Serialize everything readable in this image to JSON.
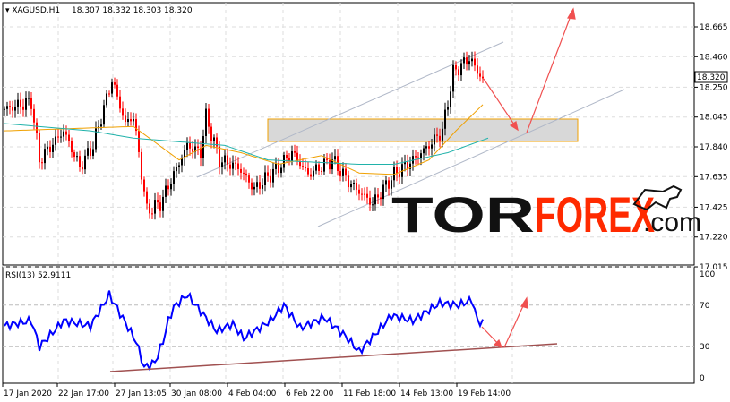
{
  "header": {
    "symbol": "XAGUSD,H1",
    "ohlc": "18.307 18.332 18.303 18.320"
  },
  "rsi_label": "RSI(13) 52.9111",
  "logo": {
    "tor": "TOR",
    "forex": "FOREX",
    "com": ".com"
  },
  "current_price": "18.320",
  "colors": {
    "bull": "#000000",
    "bear": "#ff0000",
    "ma_fast": "#f0a000",
    "ma_slow": "#20b2aa",
    "rsi": "#0000ff",
    "arrow": "#f05050",
    "channel": "#b0b8c8",
    "trend": "#a05050",
    "zone": "#d8d8d8",
    "zone_border": "#f0a000"
  },
  "chart_data": [
    {
      "type": "line",
      "title": "XAGUSD,H1",
      "ylim": [
        17.015,
        18.87
      ],
      "yticks": [
        "18.665",
        "18.460",
        "18.250",
        "18.045",
        "17.840",
        "17.635",
        "17.425",
        "17.220",
        "17.015"
      ],
      "xticks": [
        "17 Jan 2020",
        "22 Jan 17:00",
        "27 Jan 13:05",
        "30 Jan 08:00",
        "4 Feb 04:00",
        "6 Feb 22:00",
        "11 Feb 18:00",
        "14 Feb 13:00",
        "19 Feb 14:00"
      ],
      "price_path": [
        [
          0,
          18.1
        ],
        [
          10,
          18.15
        ],
        [
          13,
          17.75
        ],
        [
          22,
          17.95
        ],
        [
          28,
          17.7
        ],
        [
          33,
          17.85
        ],
        [
          40,
          18.3
        ],
        [
          45,
          18.0
        ],
        [
          48,
          18.05
        ],
        [
          53,
          17.4
        ],
        [
          58,
          17.45
        ],
        [
          63,
          17.65
        ],
        [
          68,
          17.85
        ],
        [
          73,
          17.8
        ],
        [
          75,
          18.05
        ],
        [
          80,
          17.75
        ],
        [
          87,
          17.7
        ],
        [
          93,
          17.55
        ],
        [
          102,
          17.7
        ],
        [
          107,
          17.8
        ],
        [
          113,
          17.65
        ],
        [
          122,
          17.75
        ],
        [
          128,
          17.6
        ],
        [
          137,
          17.45
        ],
        [
          145,
          17.65
        ],
        [
          152,
          17.75
        ],
        [
          158,
          17.85
        ],
        [
          163,
          17.95
        ],
        [
          167,
          18.35
        ],
        [
          173,
          18.45
        ],
        [
          178,
          18.3
        ]
      ],
      "ma_fast": [
        [
          0,
          17.95
        ],
        [
          48,
          17.98
        ],
        [
          65,
          17.75
        ],
        [
          75,
          17.85
        ],
        [
          88,
          17.8
        ],
        [
          102,
          17.72
        ],
        [
          118,
          17.78
        ],
        [
          132,
          17.66
        ],
        [
          145,
          17.65
        ],
        [
          158,
          17.75
        ],
        [
          168,
          17.95
        ],
        [
          178,
          18.13
        ]
      ],
      "ma_slow": [
        [
          0,
          18.0
        ],
        [
          32,
          17.95
        ],
        [
          48,
          17.9
        ],
        [
          82,
          17.85
        ],
        [
          98,
          17.75
        ],
        [
          132,
          17.72
        ],
        [
          145,
          17.72
        ],
        [
          165,
          17.8
        ],
        [
          180,
          17.9
        ]
      ]
    },
    {
      "type": "line",
      "title": "RSI(13)",
      "ylim": [
        0,
        100
      ],
      "yticks": [
        "100",
        "70",
        "30",
        "0"
      ],
      "values": [
        [
          0,
          50
        ],
        [
          10,
          55
        ],
        [
          13,
          30
        ],
        [
          22,
          55
        ],
        [
          32,
          50
        ],
        [
          39,
          80
        ],
        [
          43,
          62
        ],
        [
          49,
          35
        ],
        [
          52,
          10
        ],
        [
          56,
          15
        ],
        [
          59,
          35
        ],
        [
          61,
          55
        ],
        [
          63,
          68
        ],
        [
          68,
          80
        ],
        [
          79,
          45
        ],
        [
          85,
          52
        ],
        [
          89,
          38
        ],
        [
          99,
          55
        ],
        [
          104,
          70
        ],
        [
          110,
          48
        ],
        [
          119,
          58
        ],
        [
          127,
          40
        ],
        [
          132,
          25
        ],
        [
          139,
          45
        ],
        [
          144,
          60
        ],
        [
          152,
          55
        ],
        [
          162,
          72
        ],
        [
          169,
          70
        ],
        [
          174,
          75
        ],
        [
          176,
          55
        ],
        [
          178,
          53
        ]
      ]
    }
  ]
}
